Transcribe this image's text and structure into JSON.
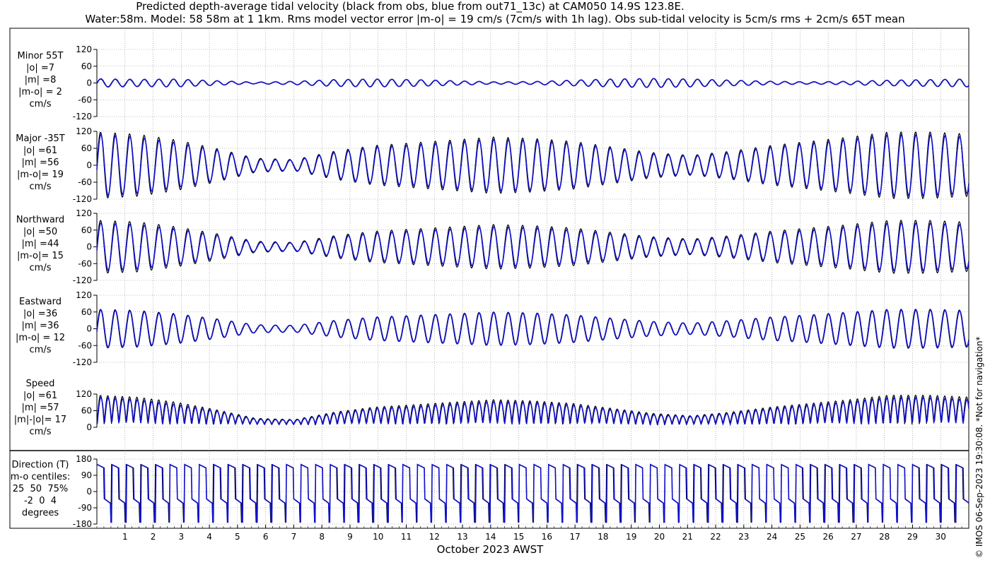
{
  "title_line1": "Predicted depth-average tidal velocity (black from obs, blue from out71_13c) at CAM050 14.9S 123.8E.",
  "title_line2": "Water:58m. Model: 58 58m at 1 1km. Rms model vector error |m-o| = 19 cm/s (7cm/s with 1h lag). Obs sub-tidal velocity is 5cm/s rms + 2cm/s 65T mean",
  "x_axis_label": "October 2023 AWST",
  "side_note": "© IMOS 06-Sep-2023 19:30:08. *Not for navigation*",
  "colors": {
    "obs": "#000000",
    "model": "#1010cc",
    "grid": "#888888"
  },
  "chart_data": [
    {
      "type": "line",
      "panel": "minor",
      "ylabel_lines": [
        "Minor 55T",
        "|o| =7",
        "|m| =8",
        "|m-o| = 2",
        "cm/s"
      ],
      "ylim": [
        -120,
        120
      ],
      "yticks": [
        -120,
        -60,
        0,
        60,
        120
      ],
      "series": [
        {
          "name": "obs",
          "amplitude_envelope": [
            14,
            12,
            14,
            8,
            3,
            6,
            12,
            14,
            12,
            8,
            4,
            5,
            10,
            14,
            16,
            14,
            10,
            6,
            4,
            6,
            10,
            12,
            14
          ]
        },
        {
          "name": "model",
          "amplitude_envelope": [
            15,
            13,
            14,
            8,
            3,
            6,
            12,
            14,
            12,
            8,
            4,
            5,
            10,
            14,
            16,
            14,
            10,
            6,
            4,
            6,
            10,
            12,
            14
          ]
        }
      ]
    },
    {
      "type": "line",
      "panel": "major",
      "ylabel_lines": [
        "Major -35T",
        "|o| =61",
        "|m| =56",
        "|m-o|= 19",
        "cm/s"
      ],
      "ylim": [
        -120,
        120
      ],
      "yticks": [
        -120,
        -60,
        0,
        60,
        120
      ],
      "series": [
        {
          "name": "obs",
          "amplitude_envelope": [
            118,
            110,
            90,
            60,
            25,
            20,
            50,
            70,
            80,
            90,
            100,
            95,
            85,
            65,
            45,
            35,
            50,
            70,
            85,
            100,
            118,
            118,
            110
          ]
        },
        {
          "name": "model",
          "amplitude_envelope": [
            110,
            100,
            80,
            55,
            22,
            18,
            45,
            65,
            72,
            82,
            92,
            88,
            78,
            60,
            40,
            32,
            45,
            64,
            78,
            92,
            108,
            108,
            100
          ]
        }
      ]
    },
    {
      "type": "line",
      "panel": "northward",
      "ylabel_lines": [
        "Northward",
        "|o| =50",
        "|m| =44",
        "|m-o|= 15",
        "cm/s"
      ],
      "ylim": [
        -120,
        120
      ],
      "yticks": [
        -120,
        -60,
        0,
        60,
        120
      ],
      "series": [
        {
          "name": "obs",
          "amplitude_envelope": [
            95,
            90,
            72,
            48,
            20,
            16,
            40,
            56,
            64,
            72,
            80,
            76,
            68,
            52,
            36,
            28,
            40,
            56,
            68,
            80,
            95,
            95,
            88
          ]
        },
        {
          "name": "model",
          "amplitude_envelope": [
            86,
            80,
            64,
            42,
            17,
            14,
            35,
            50,
            57,
            64,
            72,
            68,
            60,
            46,
            32,
            25,
            35,
            50,
            60,
            72,
            85,
            85,
            78
          ]
        }
      ]
    },
    {
      "type": "line",
      "panel": "eastward",
      "ylabel_lines": [
        "Eastward",
        "|o| =36",
        "|m| =36",
        "|m-o| = 12",
        "cm/s"
      ],
      "ylim": [
        -120,
        120
      ],
      "yticks": [
        -120,
        -60,
        0,
        60,
        120
      ],
      "series": [
        {
          "name": "obs",
          "amplitude_envelope": [
            70,
            66,
            54,
            36,
            14,
            12,
            30,
            42,
            48,
            54,
            60,
            57,
            50,
            38,
            26,
            20,
            30,
            42,
            50,
            60,
            70,
            70,
            66
          ]
        },
        {
          "name": "model",
          "amplitude_envelope": [
            68,
            64,
            52,
            35,
            14,
            12,
            29,
            41,
            47,
            53,
            59,
            56,
            49,
            37,
            26,
            20,
            29,
            41,
            49,
            59,
            68,
            68,
            64
          ]
        }
      ]
    },
    {
      "type": "line",
      "panel": "speed",
      "ylabel_lines": [
        "Speed",
        "|o| =61",
        "|m| =57",
        "|m|-|o|= 17",
        "cm/s"
      ],
      "ylim": [
        0,
        120
      ],
      "yticks": [
        0,
        60,
        120
      ],
      "series": [
        {
          "name": "obs",
          "amplitude_envelope": [
            118,
            110,
            90,
            60,
            25,
            20,
            50,
            70,
            80,
            90,
            100,
            95,
            85,
            65,
            45,
            35,
            50,
            70,
            85,
            100,
            118,
            118,
            110
          ]
        },
        {
          "name": "model",
          "amplitude_envelope": [
            110,
            100,
            80,
            55,
            22,
            18,
            45,
            65,
            72,
            82,
            92,
            88,
            78,
            60,
            40,
            32,
            45,
            64,
            78,
            92,
            108,
            108,
            100
          ]
        }
      ]
    },
    {
      "type": "line",
      "panel": "direction",
      "ylabel_lines": [
        "Direction (T)",
        "m-o centiles:",
        "25  50  75%",
        "-2  0  4",
        "degrees"
      ],
      "ylim": [
        -180,
        180
      ],
      "yticks": [
        -180,
        -90,
        0,
        90,
        180
      ],
      "series": [
        {
          "name": "obs"
        },
        {
          "name": "model"
        }
      ]
    }
  ],
  "x_axis": {
    "xlim": [
      0,
      31
    ],
    "day_ticks": [
      "1",
      "2",
      "3",
      "4",
      "5",
      "6",
      "7",
      "8",
      "9",
      "10",
      "11",
      "12",
      "13",
      "14",
      "15",
      "16",
      "17",
      "18",
      "19",
      "20",
      "21",
      "22",
      "23",
      "24",
      "25",
      "26",
      "27",
      "28",
      "29",
      "30"
    ]
  }
}
